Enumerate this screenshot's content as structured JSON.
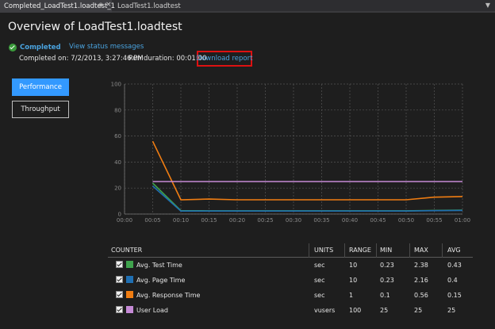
{
  "tabs": [
    {
      "label": "Completed_LoadTest1.loadtest_1",
      "active": true
    },
    {
      "label": "LoadTest1.loadtest",
      "active": false
    }
  ],
  "icons": {
    "pin": "pin-icon",
    "close": "close-icon",
    "dropdown": "chevron-down-icon",
    "status": "check-circle-icon"
  },
  "header": {
    "title": "Overview of LoadTest1.loadtest",
    "status": "Completed",
    "view_status_link": "View status messages",
    "completed_on": "Completed on: 7/2/2013, 3:27:46 PM",
    "run_duration": "Run duration: 00:01:00",
    "download_report": "Download report"
  },
  "side_buttons": {
    "performance": "Performance",
    "throughput": "Throughput",
    "selected": "Performance"
  },
  "colors": {
    "accent": "#3399ff",
    "link": "#4aa3df",
    "highlight_box": "#dd1111"
  },
  "chart_data": {
    "type": "line",
    "x": [
      "00:00",
      "00:05",
      "00:10",
      "00:15",
      "00:20",
      "00:25",
      "00:30",
      "00:35",
      "00:40",
      "00:45",
      "00:50",
      "00:55",
      "01:00"
    ],
    "ylim": [
      0,
      100
    ],
    "yticks": [
      0,
      20,
      40,
      60,
      80,
      100
    ],
    "grid": true,
    "series": [
      {
        "name": "Avg. Test Time",
        "color": "#3fa34d",
        "x": [
          "00:05",
          "00:10",
          "00:15",
          "00:20",
          "00:25",
          "00:30",
          "00:35",
          "00:40",
          "00:45",
          "00:50",
          "00:55",
          "01:00"
        ],
        "values": [
          23.8,
          2.6,
          2.5,
          2.5,
          2.5,
          2.5,
          2.5,
          2.5,
          2.5,
          2.5,
          2.8,
          3.0
        ]
      },
      {
        "name": "Avg. Page Time",
        "color": "#1f6fb2",
        "x": [
          "00:05",
          "00:10",
          "00:15",
          "00:20",
          "00:25",
          "00:30",
          "00:35",
          "00:40",
          "00:45",
          "00:50",
          "00:55",
          "01:00"
        ],
        "values": [
          21.6,
          2.3,
          2.3,
          2.3,
          2.3,
          2.3,
          2.3,
          2.3,
          2.3,
          2.3,
          2.6,
          2.8
        ]
      },
      {
        "name": "Avg. Response Time",
        "color": "#f07d12",
        "x": [
          "00:05",
          "00:10",
          "00:15",
          "00:20",
          "00:25",
          "00:30",
          "00:35",
          "00:40",
          "00:45",
          "00:50",
          "00:55",
          "01:00"
        ],
        "values": [
          56,
          11,
          11.5,
          11,
          11,
          11,
          11,
          11,
          11,
          11,
          13,
          13.5
        ]
      },
      {
        "name": "User Load",
        "color": "#c58ad6",
        "x": [
          "00:05",
          "00:10",
          "00:15",
          "00:20",
          "00:25",
          "00:30",
          "00:35",
          "00:40",
          "00:45",
          "00:50",
          "00:55",
          "01:00"
        ],
        "values": [
          25,
          25,
          25,
          25,
          25,
          25,
          25,
          25,
          25,
          25,
          25,
          25
        ]
      }
    ]
  },
  "table": {
    "headers": {
      "counter": "COUNTER",
      "units": "UNITS",
      "range": "RANGE",
      "min": "MIN",
      "max": "MAX",
      "avg": "AVG"
    },
    "rows": [
      {
        "counter": "Avg. Test Time",
        "color": "#3fa34d",
        "units": "sec",
        "range": "10",
        "min": "0.23",
        "max": "2.38",
        "avg": "0.43"
      },
      {
        "counter": "Avg. Page Time",
        "color": "#1f6fb2",
        "units": "sec",
        "range": "10",
        "min": "0.23",
        "max": "2.16",
        "avg": "0.4"
      },
      {
        "counter": "Avg. Response Time",
        "color": "#f07d12",
        "units": "sec",
        "range": "1",
        "min": "0.1",
        "max": "0.56",
        "avg": "0.15"
      },
      {
        "counter": "User Load",
        "color": "#c58ad6",
        "units": "vusers",
        "range": "100",
        "min": "25",
        "max": "25",
        "avg": "25"
      }
    ]
  }
}
